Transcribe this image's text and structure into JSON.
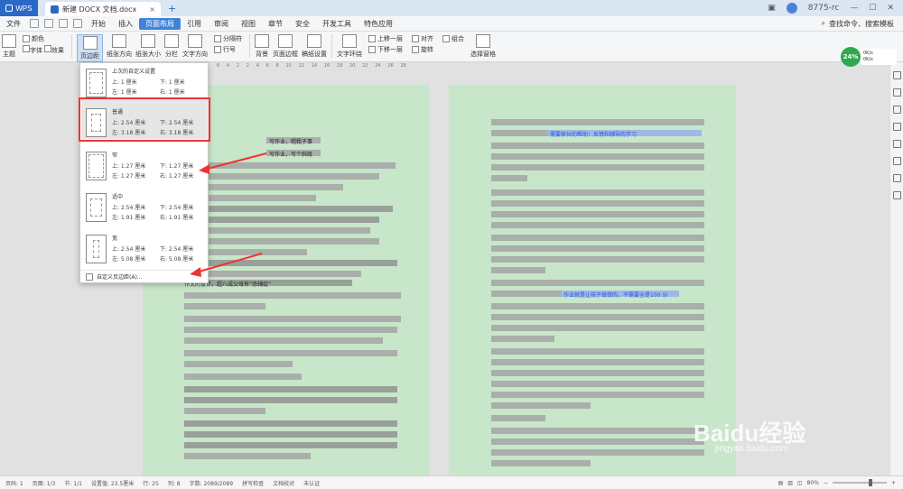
{
  "titlebar": {
    "app": "WPS",
    "tab": "新建 DOCX 文档.docx",
    "user": "8775-rc"
  },
  "menu": {
    "file": "文件",
    "items": [
      "开始",
      "插入",
      "页面布局",
      "引用",
      "审阅",
      "视图",
      "章节",
      "安全",
      "开发工具",
      "特色应用"
    ],
    "active_index": 2,
    "search": "查找命令、搜索模板"
  },
  "ribbon": {
    "theme": "主题",
    "color": "颜色",
    "font": "字体",
    "effect": "效果",
    "margins": "页边距",
    "orientation": "纸张方向",
    "size": "纸张大小",
    "columns": "分栏",
    "text_dir": "文字方向",
    "line_num": "行号",
    "sep": "分隔符",
    "page_bg": "背景",
    "page_border": "页面边框",
    "draft": "稿纸设置",
    "wrap": "文字环绕",
    "align": "对齐",
    "rotate": "旋转",
    "group": "组合",
    "select": "选择窗格",
    "up": "上移一层",
    "down": "下移一层"
  },
  "speed": {
    "percent": "24%",
    "up": "0K/s",
    "down": "0K/s"
  },
  "margins_menu": {
    "options": [
      {
        "name": "上次的自定义设置",
        "top": "上: 1 厘米",
        "bottom": "下: 1 厘米",
        "left": "左: 1 厘米",
        "right": "右: 1 厘米"
      },
      {
        "name": "普通",
        "top": "上: 2.54 厘米",
        "bottom": "下: 2.54 厘米",
        "left": "左: 3.18 厘米",
        "right": "右: 3.18 厘米"
      },
      {
        "name": "窄",
        "top": "上: 1.27 厘米",
        "bottom": "下: 1.27 厘米",
        "left": "左: 1.27 厘米",
        "right": "右: 1.27 厘米"
      },
      {
        "name": "适中",
        "top": "上: 2.54 厘米",
        "bottom": "下: 2.54 厘米",
        "left": "左: 1.91 厘米",
        "right": "右: 1.91 厘米"
      },
      {
        "name": "宽",
        "top": "上: 2.54 厘米",
        "bottom": "下: 2.54 厘米",
        "left": "左: 5.08 厘米",
        "right": "右: 5.08 厘米"
      }
    ],
    "custom": "自定义页边距(A)..."
  },
  "doc": {
    "left_head1": "写作业，唱粗子事",
    "left_head2": "写作业，写个斜既",
    "left_b1": "作文的设计，超八成父母有“恐辅症”",
    "right_blue1": "需要家长的帮助：反馈和辅导的学习",
    "right_blue2": "作业就是让孩子做错的，不需要全是100 分"
  },
  "status": {
    "page": "页码: 1",
    "pages": "页面: 1/3",
    "section": "节: 1/1",
    "setvalue": "设置值: 23.5厘米",
    "row": "行: 25",
    "col": "列: 8",
    "words": "字数: 2089/2089",
    "spell": "拼写检查",
    "proof": "文档校对",
    "cert": "未认证",
    "zoom": "80%"
  },
  "watermark": {
    "brand": "Baidu经验",
    "url": "jingyan.baidu.com"
  }
}
